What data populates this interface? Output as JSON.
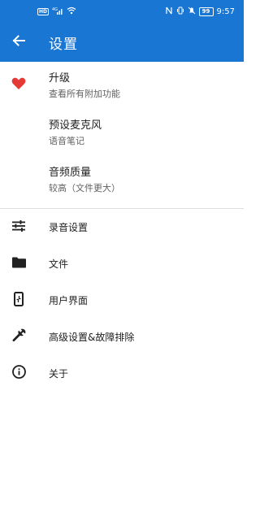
{
  "status_bar": {
    "network_badge": "HD",
    "signal": "4G",
    "battery": "99",
    "time": "9:57"
  },
  "app_bar": {
    "title": "设置",
    "back_icon": "arrow-back-icon"
  },
  "colors": {
    "primary": "#1976d2",
    "heart": "#e53935",
    "icon": "#212121",
    "divider": "#dddddd"
  },
  "top_items": [
    {
      "title": "升级",
      "subtitle": "查看所有附加功能",
      "icon": "heart-icon"
    },
    {
      "title": "预设麦克风",
      "subtitle": "语音笔记",
      "icon": ""
    },
    {
      "title": "音频质量",
      "subtitle": "较高（文件更大）",
      "icon": ""
    }
  ],
  "menu_items": [
    {
      "title": "录音设置",
      "icon": "tune-icon"
    },
    {
      "title": "文件",
      "icon": "folder-icon"
    },
    {
      "title": "用户界面",
      "icon": "phone-icon"
    },
    {
      "title": "高级设置&故障排除",
      "icon": "wrench-icon"
    },
    {
      "title": "关于",
      "icon": "info-icon"
    }
  ]
}
